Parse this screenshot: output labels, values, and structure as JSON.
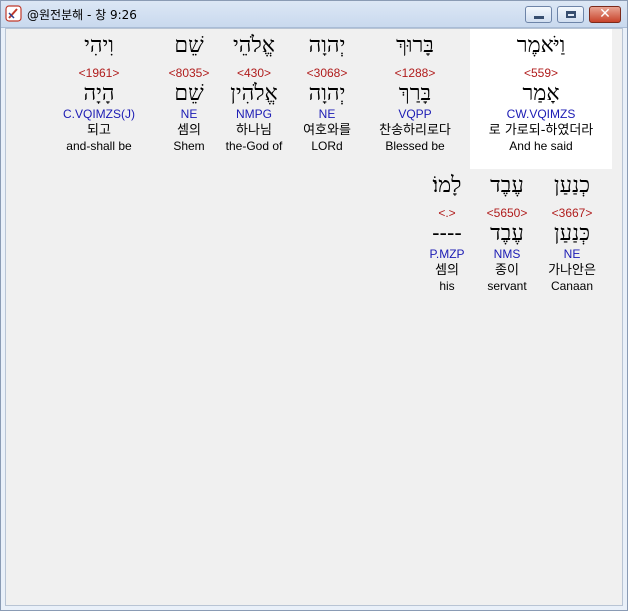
{
  "window": {
    "title": "@원전분해 - 창 9:26",
    "close_glyph": "✕"
  },
  "rows": [
    [
      {
        "heb": "וַיֹּאמֶר",
        "strong": "<559>",
        "lemma": "אָמַר",
        "morph": "CW.VQIMZS",
        "kor": "로 가로되-하였더라",
        "eng": "And he said",
        "selected": true
      },
      {
        "heb": "בָּרוּךְ",
        "strong": "<1288>",
        "lemma": "בָּרַךְ",
        "morph": "VQPP",
        "kor": "찬송하리로다",
        "eng": "Blessed be",
        "selected": false
      },
      {
        "heb": "יְהוָה",
        "strong": "<3068>",
        "lemma": "יְהוָה",
        "morph": "NE",
        "kor": "여호와를",
        "eng": "LORd",
        "selected": false
      },
      {
        "heb": "אֱלֹהֵי",
        "strong": "<430>",
        "lemma": "אֱלֹהִין",
        "morph": "NMPG",
        "kor": "하나님",
        "eng": "the-God of",
        "selected": false
      },
      {
        "heb": "שֵׁם",
        "strong": "<8035>",
        "lemma": "שֵׁם",
        "morph": "NE",
        "kor": "셈의",
        "eng": "Shem",
        "selected": false
      },
      {
        "heb": "וִיהִי",
        "strong": "<1961>",
        "lemma": "הָיָה",
        "morph": "C.VQIMZS(J)",
        "kor": "되고",
        "eng": "and-shall be",
        "selected": false
      }
    ],
    [
      {
        "heb": "כְנַעַן",
        "strong": "<3667>",
        "lemma": "כְּנַעַן",
        "morph": "NE",
        "kor": "가나안은",
        "eng": "Canaan",
        "selected": false
      },
      {
        "heb": "עֶבֶד",
        "strong": "<5650>",
        "lemma": "עֶבֶד",
        "morph": "NMS",
        "kor": "종이",
        "eng": "servant",
        "selected": false
      },
      {
        "heb": "לָמוֹ׃",
        "strong": "<.>",
        "lemma": "----",
        "morph": "P.MZP",
        "kor": "셈의",
        "eng": "his",
        "selected": false
      }
    ]
  ]
}
